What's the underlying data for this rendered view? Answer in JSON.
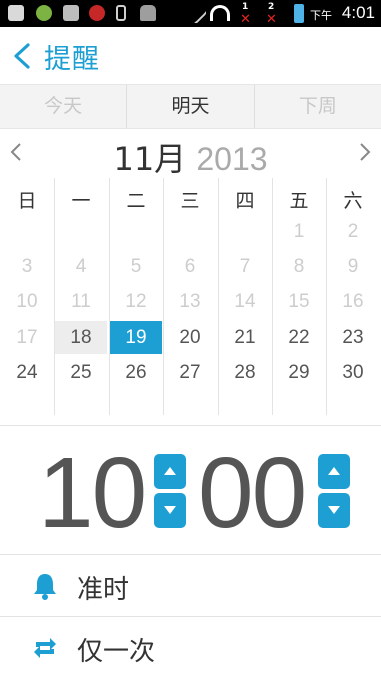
{
  "status_bar": {
    "ampm": "下午",
    "time": "4:01",
    "sim1": "1",
    "sim2": "2"
  },
  "header": {
    "title": "提醒",
    "back_icon": "chevron-left-icon"
  },
  "day_tabs": [
    {
      "label": "今天",
      "active": false
    },
    {
      "label": "明天",
      "active": true
    },
    {
      "label": "下周",
      "active": false
    }
  ],
  "month_header": {
    "month": "11月",
    "year": "2013"
  },
  "calendar": {
    "weekdays": [
      "日",
      "一",
      "二",
      "三",
      "四",
      "五",
      "六"
    ],
    "weeks": [
      [
        "",
        "",
        "",
        "",
        "",
        "1",
        "2"
      ],
      [
        "3",
        "4",
        "5",
        "6",
        "7",
        "8",
        "9"
      ],
      [
        "10",
        "11",
        "12",
        "13",
        "14",
        "15",
        "16"
      ],
      [
        "17",
        "18",
        "19",
        "20",
        "21",
        "22",
        "23"
      ],
      [
        "24",
        "25",
        "26",
        "27",
        "28",
        "29",
        "30"
      ]
    ],
    "today": "18",
    "selected": "19"
  },
  "time": {
    "hour": "10",
    "minute": "00"
  },
  "options": [
    {
      "label": "准时",
      "icon": "bell-icon"
    },
    {
      "label": "仅一次",
      "icon": "repeat-icon"
    }
  ],
  "colors": {
    "accent": "#1e9fd3",
    "text": "#333333",
    "dim": "#cdcdcd"
  }
}
